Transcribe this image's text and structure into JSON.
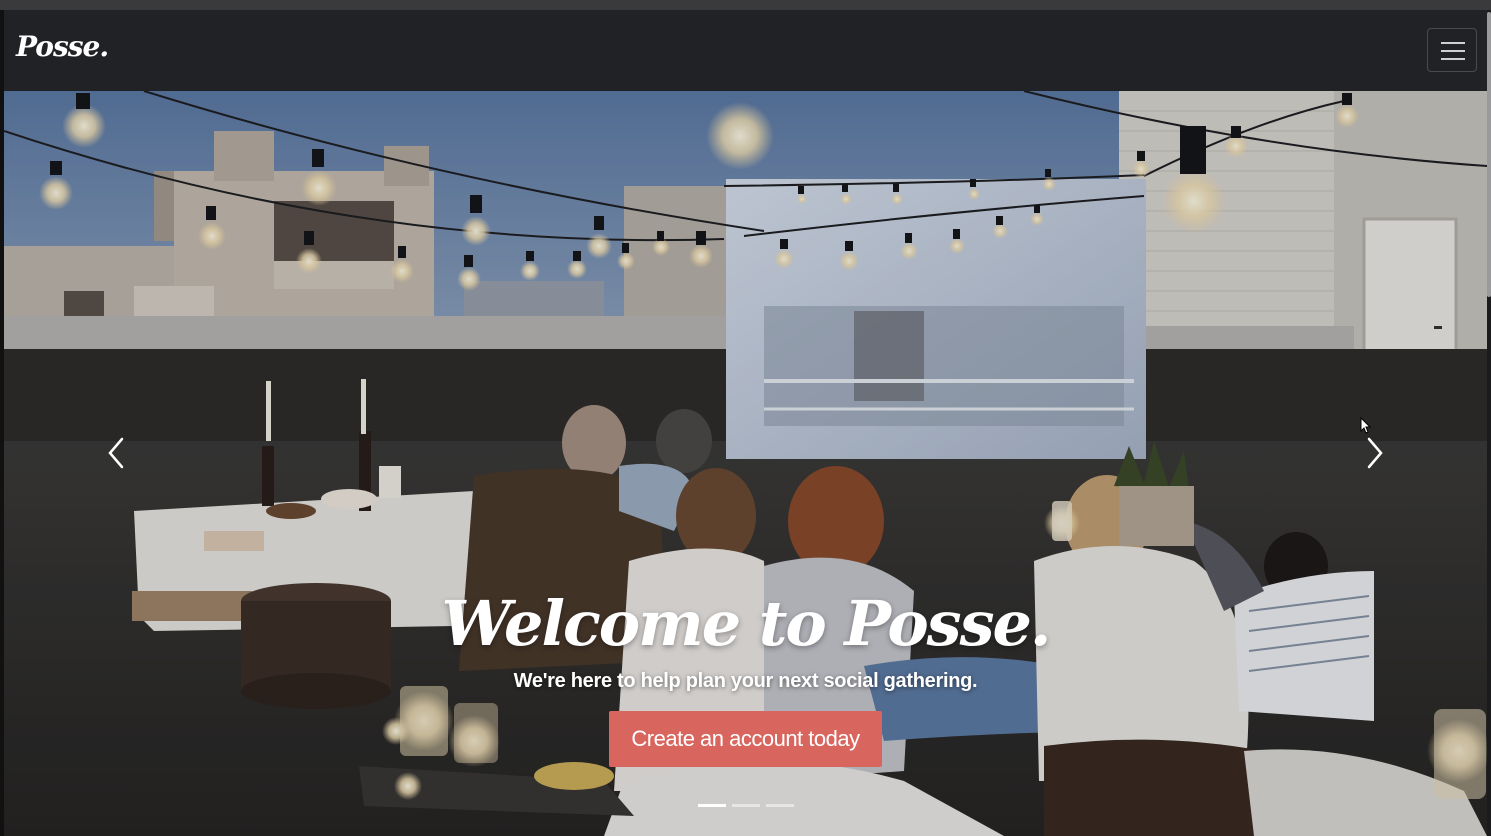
{
  "navbar": {
    "brand": "Posse.",
    "menu_icon": "hamburger-menu-icon"
  },
  "hero": {
    "title": "Welcome to Posse.",
    "subtitle": "We're here to help plan your next social gathering.",
    "cta_label": "Create an account today",
    "prev_icon": "chevron-left-icon",
    "next_icon": "chevron-right-icon",
    "slide_count": 3,
    "active_slide": 1
  },
  "colors": {
    "navbar_bg": "#212226",
    "cta_bg": "#d9665e",
    "text": "#ffffff"
  }
}
